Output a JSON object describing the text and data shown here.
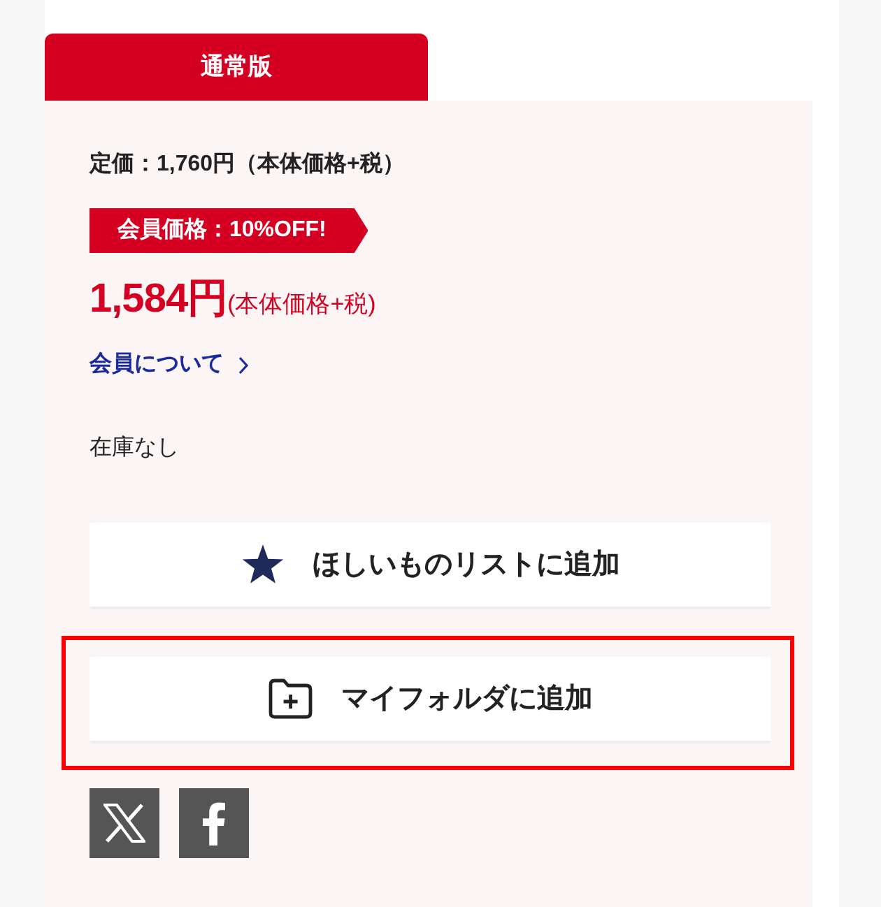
{
  "edition_tab": {
    "label": "通常版",
    "selected": true
  },
  "list_price": "定価：1,760円（本体価格+税）",
  "member_badge": "会員価格：10%OFF!",
  "member_price": {
    "amount": "1,584円",
    "note": "(本体価格+税)"
  },
  "member_link": "会員について",
  "stock": "在庫なし",
  "actions": [
    {
      "kind": "wishlist",
      "label": "ほしいものリストに追加",
      "highlighted": false
    },
    {
      "kind": "folder",
      "label": "マイフォルダに追加",
      "highlighted": true
    }
  ],
  "share": [
    {
      "kind": "x"
    },
    {
      "kind": "facebook"
    }
  ]
}
